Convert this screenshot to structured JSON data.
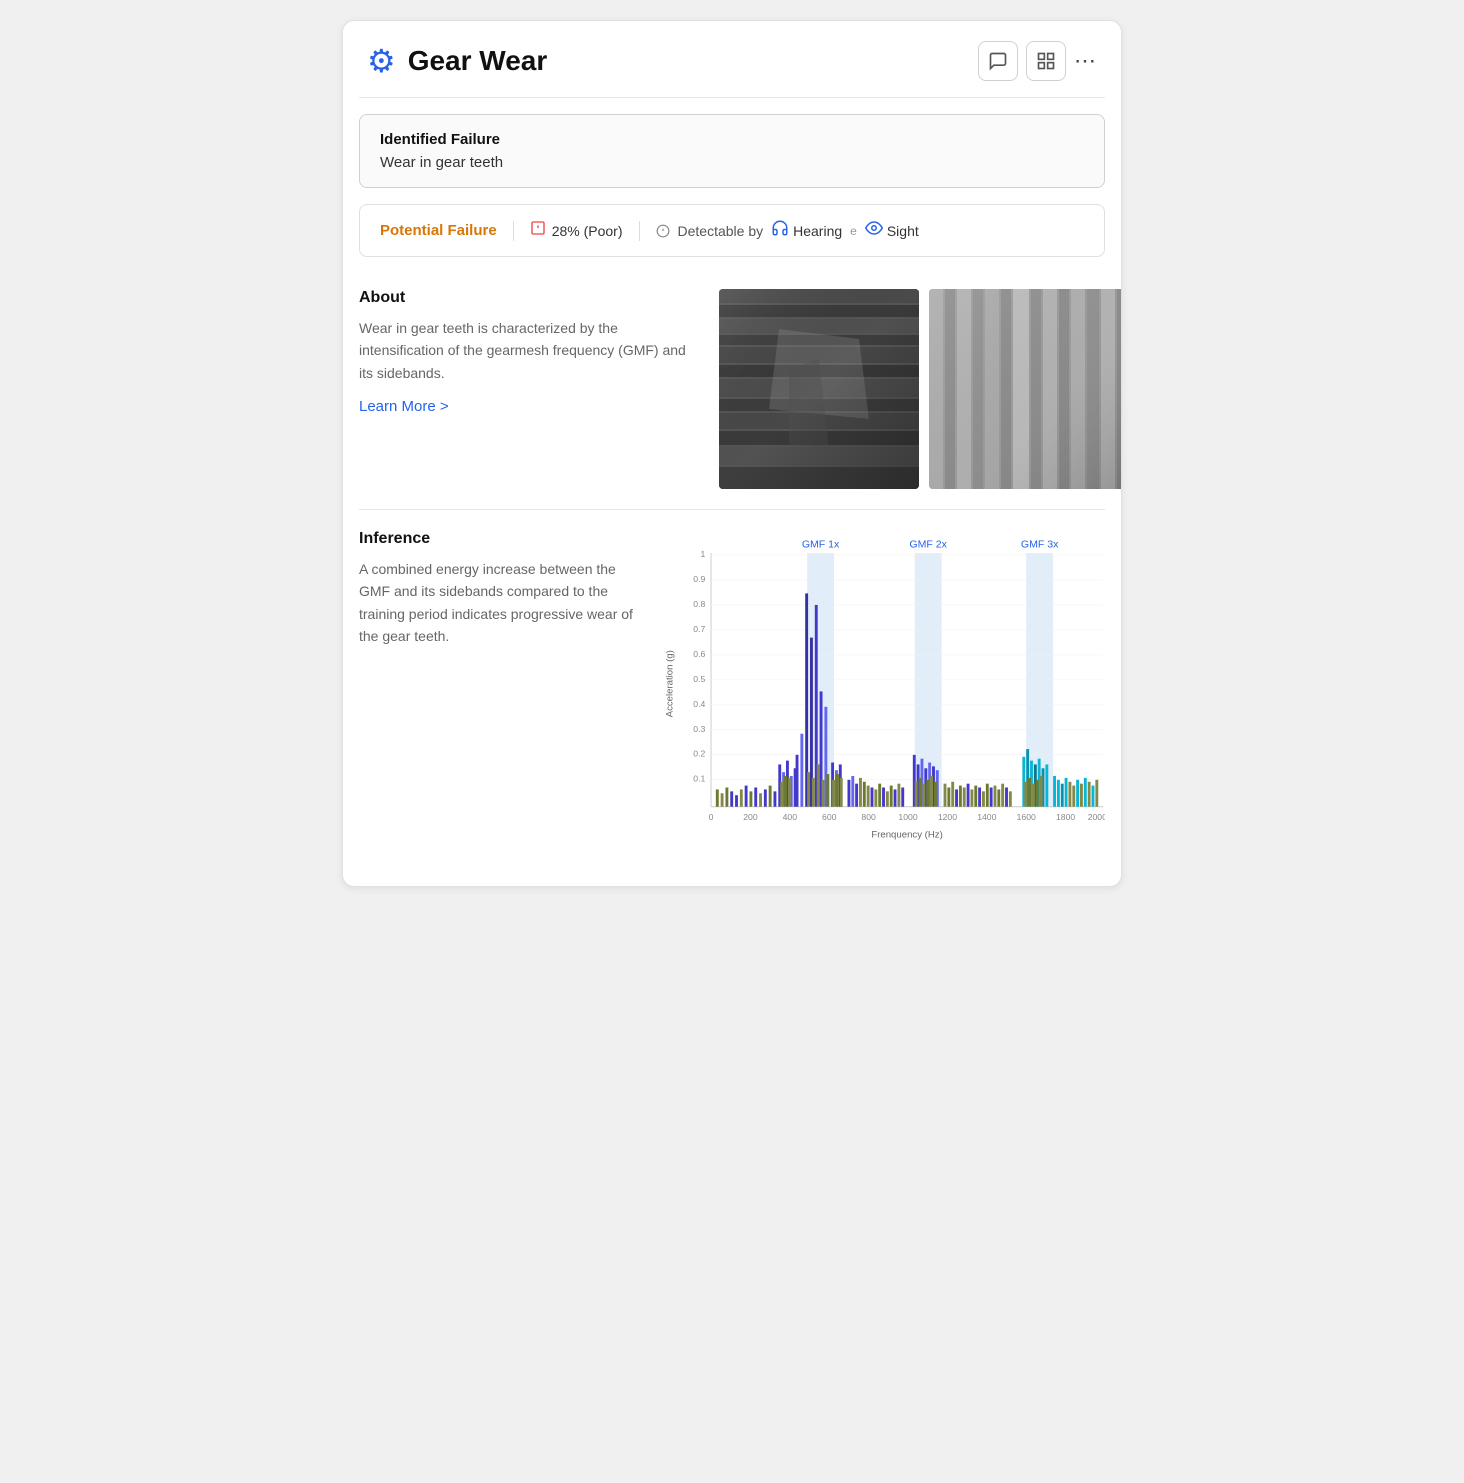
{
  "header": {
    "title": "Gear Wear",
    "icon": "⚙",
    "actions": {
      "chat_label": "💬",
      "expand_label": "⊞",
      "more_label": "⋯"
    }
  },
  "identified_failure": {
    "label": "Identified Failure",
    "value": "Wear in gear teeth"
  },
  "potential_failure": {
    "label": "Potential Failure",
    "score": "28% (Poor)",
    "detectable_by_label": "Detectable by",
    "senses": [
      {
        "name": "Hearing",
        "icon": "👂"
      },
      {
        "name": "Sight",
        "icon": "👁"
      }
    ],
    "separator": "e"
  },
  "about": {
    "title": "About",
    "description": "Wear in gear teeth is characterized by the intensification of the gearmesh frequency (GMF) and its sidebands.",
    "learn_more": "Learn More >"
  },
  "inference": {
    "title": "Inference",
    "description": "A combined energy increase between the GMF and its sidebands compared to the training period indicates progressive wear of the gear teeth."
  },
  "chart": {
    "y_label": "Acceleration (g)",
    "x_label": "Frenquency (Hz)",
    "y_ticks": [
      "1",
      "0.9",
      "0.8",
      "0.7",
      "0.6",
      "0.5",
      "0.4",
      "0.3",
      "0.2",
      "0.1"
    ],
    "x_ticks": [
      "0",
      "200",
      "400",
      "600",
      "800",
      "1000",
      "1200",
      "1400",
      "1600",
      "1800",
      "2000"
    ],
    "annotations": [
      {
        "label": "GMF 1x",
        "x_center": 480
      },
      {
        "label": "GMF 2x",
        "x_center": 1020
      },
      {
        "label": "GMF 3x",
        "x_center": 1540
      }
    ]
  }
}
